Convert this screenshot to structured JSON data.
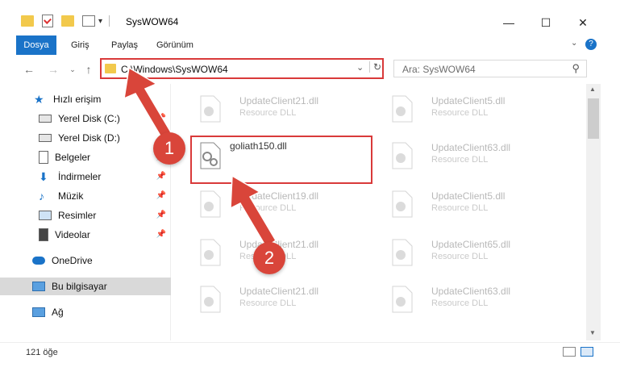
{
  "window": {
    "title": "SysWOW64"
  },
  "ribbon": {
    "tabs": [
      {
        "label": "Dosya",
        "active": true
      },
      {
        "label": "Giriş",
        "active": false
      },
      {
        "label": "Paylaş",
        "active": false
      },
      {
        "label": "Görünüm",
        "active": false
      }
    ]
  },
  "nav": {
    "address": "C:\\Windows\\SysWOW64",
    "search_placeholder": "Ara: SysWOW64"
  },
  "sidebar": {
    "items": [
      {
        "label": "Hızlı erişim",
        "icon": "star-icon",
        "pinned": false
      },
      {
        "label": "Yerel Disk (C:)",
        "icon": "drive-icon",
        "pinned": true
      },
      {
        "label": "Yerel Disk (D:)",
        "icon": "drive-icon",
        "pinned": false
      },
      {
        "label": "Belgeler",
        "icon": "document-icon",
        "pinned": true
      },
      {
        "label": "İndirmeler",
        "icon": "download-icon",
        "pinned": true
      },
      {
        "label": "Müzik",
        "icon": "music-icon",
        "pinned": true
      },
      {
        "label": "Resimler",
        "icon": "pictures-icon",
        "pinned": true
      },
      {
        "label": "Videolar",
        "icon": "video-icon",
        "pinned": true
      },
      {
        "label": "OneDrive",
        "icon": "cloud-icon",
        "pinned": false
      },
      {
        "label": "Bu bilgisayar",
        "icon": "computer-icon",
        "pinned": false,
        "selected": true
      },
      {
        "label": "Ağ",
        "icon": "network-icon",
        "pinned": false
      }
    ]
  },
  "files": [
    {
      "name": "UpdateClient21.dll",
      "type": "Resource DLL"
    },
    {
      "name": "UpdateClient5.dll",
      "type": "Resource DLL"
    },
    {
      "name": "goliath150.dll",
      "type": "",
      "focus": true
    },
    {
      "name": "UpdateClient63.dll",
      "type": "Resource DLL"
    },
    {
      "name": "UpdateClient19.dll",
      "type": "Resource DLL"
    },
    {
      "name": "UpdateClient5.dll",
      "type": "Resource DLL"
    },
    {
      "name": "UpdateClient21.dll",
      "type": "Resource DLL"
    },
    {
      "name": "UpdateClient65.dll",
      "type": "Resource DLL"
    },
    {
      "name": "UpdateClient21.dll",
      "type": "Resource DLL"
    },
    {
      "name": "UpdateClient63.dll",
      "type": "Resource DLL"
    }
  ],
  "status": {
    "count": "121 öğe"
  },
  "annotations": {
    "step1": "1",
    "step2": "2"
  },
  "colors": {
    "accent": "#1a73c8",
    "highlight": "#d93a3a",
    "arrow": "#d9453a"
  }
}
